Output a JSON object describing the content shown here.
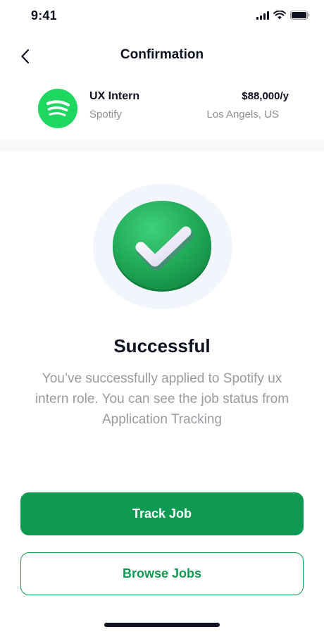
{
  "status_bar": {
    "time": "9:41"
  },
  "header": {
    "title": "Confirmation"
  },
  "job": {
    "title": "UX Intern",
    "company": "Spotify",
    "salary": "$88,000/y",
    "location": "Los Angels, US"
  },
  "result": {
    "heading": "Successful",
    "message": "You’ve successfully applied to Spotify ux intern role. You can see the job status from Application Tracking"
  },
  "actions": {
    "primary_label": "Track Job",
    "secondary_label": "Browse Jobs"
  },
  "icons": {
    "back": "chevron-left-icon",
    "company_logo": "spotify-logo",
    "success": "check-circle-icon",
    "signal": "cellular-signal-icon",
    "wifi": "wifi-icon",
    "battery": "battery-icon"
  },
  "colors": {
    "brand_green": "#0e9a53",
    "spotify_green": "#1ed760",
    "text_dark": "#0f1222",
    "text_muted": "#9a9aa0"
  }
}
